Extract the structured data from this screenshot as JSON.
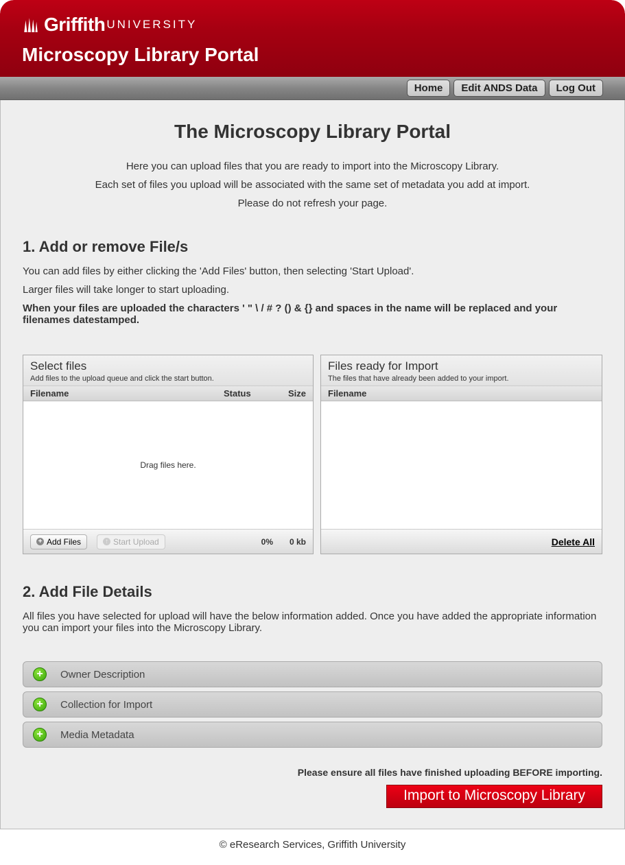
{
  "header": {
    "logo_griffith": "Griffith",
    "logo_university": "UNIVERSITY",
    "portal_title": "Microscopy Library Portal"
  },
  "nav": {
    "home": "Home",
    "edit": "Edit ANDS Data",
    "logout": "Log Out"
  },
  "main": {
    "title": "The Microscopy Library Portal",
    "intro1": "Here you can upload files that you are ready to import into the Microscopy Library.",
    "intro2": "Each set of files you upload will be associated with the same set of metadata you add at import.",
    "intro3": "Please do not refresh your page."
  },
  "section1": {
    "heading": "1. Add or remove File/s",
    "p1": "You can add files by either clicking the 'Add Files' button, then selecting 'Start Upload'.",
    "p2": "Larger files will take longer to start uploading.",
    "p3": "When your files are uploaded the characters ' \" \\ / # ? () & {} and spaces in the name will be replaced and your filenames datestamped."
  },
  "upload_panel": {
    "title": "Select files",
    "subtitle": "Add files to the upload queue and click the start button.",
    "col_filename": "Filename",
    "col_status": "Status",
    "col_size": "Size",
    "drop_hint": "Drag files here.",
    "add_files": "Add Files",
    "start_upload": "Start Upload",
    "pct": "0%",
    "size": "0 kb"
  },
  "ready_panel": {
    "title": "Files ready for Import",
    "subtitle": "The files that have already been added to your import.",
    "col_filename": "Filename",
    "delete_all": "Delete All"
  },
  "section2": {
    "heading": "2. Add File Details",
    "p1": "All files you have selected for upload will have the below information added. Once you have added the appropriate information you can import your files into the Microscopy Library."
  },
  "accordion": {
    "items": [
      {
        "label": "Owner Description"
      },
      {
        "label": "Collection for Import"
      },
      {
        "label": "Media Metadata"
      }
    ]
  },
  "import": {
    "warning": "Please ensure all files have finished uploading BEFORE importing.",
    "button": "Import to Microscopy Library"
  },
  "footer": {
    "text": "© eResearch Services, Griffith University"
  }
}
